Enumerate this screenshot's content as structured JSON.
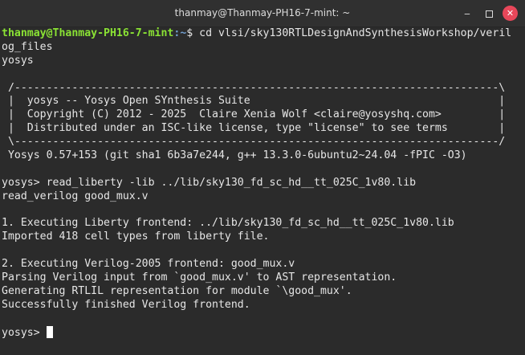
{
  "window": {
    "title": "thanmay@Thanmay-PH16-7-mint: ~",
    "minimize_glyph": "‒",
    "close_glyph": "✕"
  },
  "terminal": {
    "prompt_user_host": "thanmay@Thanmay-PH16-7-mint",
    "prompt_path": ":~",
    "prompt_symbol": "$ ",
    "command_1": "cd vlsi/sky130RTLDesignAndSynthesisWorkshop/veril",
    "command_1_wrap": "og_files",
    "lines": [
      "yosys",
      "",
      " /----------------------------------------------------------------------------\\",
      " |  yosys -- Yosys Open SYnthesis Suite                                       |",
      " |  Copyright (C) 2012 - 2025  Claire Xenia Wolf <claire@yosyshq.com>         |",
      " |  Distributed under an ISC-like license, type \"license\" to see terms        |",
      " \\----------------------------------------------------------------------------/",
      " Yosys 0.57+153 (git sha1 6b3a7e244, g++ 13.3.0-6ubuntu2~24.04 -fPIC -O3)",
      "",
      "yosys> read_liberty -lib ../lib/sky130_fd_sc_hd__tt_025C_1v80.lib",
      "read_verilog good_mux.v",
      "",
      "1. Executing Liberty frontend: ../lib/sky130_fd_sc_hd__tt_025C_1v80.lib",
      "Imported 418 cell types from liberty file.",
      "",
      "2. Executing Verilog-2005 frontend: good_mux.v",
      "Parsing Verilog input from `good_mux.v' to AST representation.",
      "Generating RTLIL representation for module `\\good_mux'.",
      "Successfully finished Verilog frontend.",
      ""
    ],
    "final_prompt": "yosys> "
  }
}
